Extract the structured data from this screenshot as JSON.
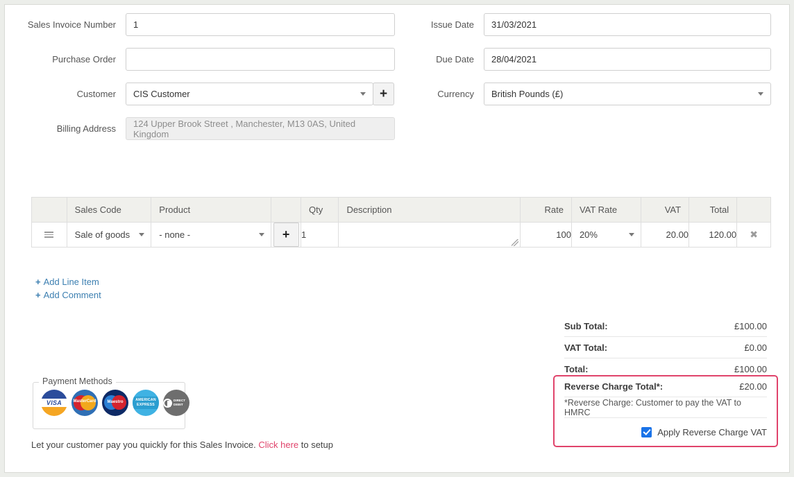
{
  "form": {
    "left_fields": [
      {
        "label": "Sales Invoice Number",
        "value": "1",
        "type": "text"
      },
      {
        "label": "Purchase Order",
        "value": "",
        "type": "text"
      },
      {
        "label": "Customer",
        "value": "CIS Customer",
        "type": "select"
      },
      {
        "label": "Billing Address",
        "value": "124 Upper Brook Street , Manchester, M13 0AS, United Kingdom",
        "type": "readonly"
      }
    ],
    "right_fields": [
      {
        "label": "Issue Date",
        "value": "31/03/2021",
        "type": "text"
      },
      {
        "label": "Due Date",
        "value": "28/04/2021",
        "type": "text"
      },
      {
        "label": "Currency",
        "value": "British Pounds (£)",
        "type": "select"
      }
    ],
    "add_customer_button": "+"
  },
  "line_items": {
    "columns": [
      "",
      "Sales Code",
      "Product",
      "",
      "Qty",
      "Description",
      "Rate",
      "VAT Rate",
      "VAT",
      "Total",
      ""
    ],
    "rows": [
      {
        "sales_code": "Sale of goods",
        "product": "- none -",
        "add_product_button": "+",
        "qty": "1",
        "description": "",
        "rate": "100",
        "vat_rate": "20%",
        "vat": "20.00",
        "total": "120.00",
        "delete_icon": "✖"
      }
    ]
  },
  "actions": {
    "add_line_item": "Add Line Item",
    "add_comment": "Add Comment",
    "plus_glyph": "+"
  },
  "totals": [
    {
      "label": "Sub Total:",
      "value": "£100.00"
    },
    {
      "label": "VAT Total:",
      "value": "£0.00"
    },
    {
      "label": "Total:",
      "value": "£100.00"
    }
  ],
  "reverse_charge": {
    "label": "Reverse Charge Total*:",
    "value": "£20.00",
    "note": "*Reverse Charge: Customer to pay the VAT to HMRC",
    "checkbox_label": "Apply Reverse Charge VAT",
    "checked": true,
    "highlight_color": "#e0436b"
  },
  "payment_methods": {
    "legend": "Payment Methods",
    "icons": [
      {
        "name": "visa",
        "label": "VISA"
      },
      {
        "name": "mastercard",
        "label": "MasterCard"
      },
      {
        "name": "maestro",
        "label": "Maestro"
      },
      {
        "name": "amex",
        "label": "AMERICAN EXPRESS"
      },
      {
        "name": "direct-debit",
        "label": "DIRECT DEBIT"
      }
    ],
    "note_before": "Let your customer pay you quickly for this Sales Invoice. ",
    "note_link": "Click here",
    "note_after": " to setup",
    "link_color": "#e0436b"
  }
}
